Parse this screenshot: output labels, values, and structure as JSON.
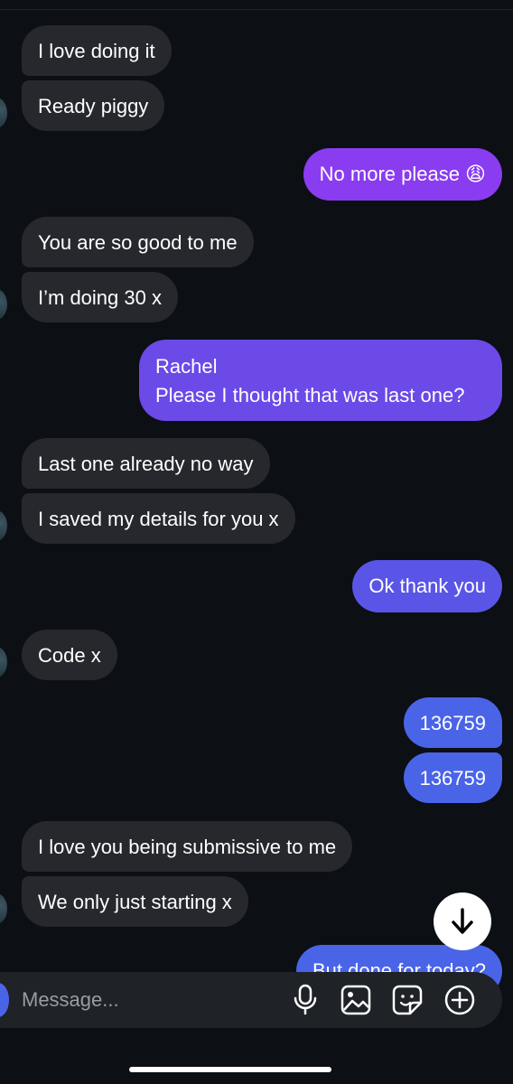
{
  "messages": {
    "m1": "I love doing it",
    "m2": "Ready piggy",
    "m3": "No more please 😩",
    "m4": "You are so good to me",
    "m5": "I’m doing 30 x",
    "m6_line1": "Rachel",
    "m6_line2": "Please I thought that was last one?",
    "m7": "Last one already no way",
    "m8": "I saved my details for you x",
    "m9": "Ok thank you",
    "m10": "Code x",
    "m11": "136759",
    "m12": "136759",
    "m13": "I love you being submissive to me",
    "m14": "We only just starting x",
    "m15": "But done for today?"
  },
  "composer": {
    "placeholder": "Message...",
    "icons": [
      "microphone-icon",
      "image-icon",
      "sticker-icon",
      "add-icon"
    ]
  },
  "colors": {
    "background": "#0c0f14",
    "incoming_bubble": "#26282d",
    "outgoing_purple": "#8a3cf0",
    "outgoing_violet": "#6b4ae8",
    "outgoing_blue": "#4a64e8"
  }
}
